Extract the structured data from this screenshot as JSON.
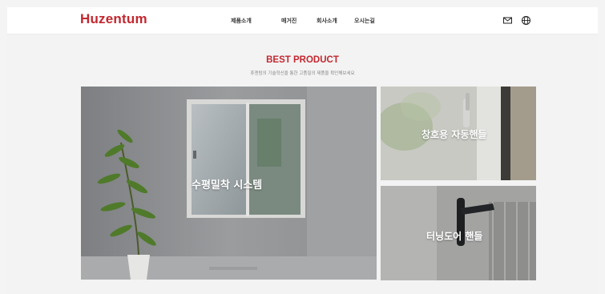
{
  "header": {
    "logo": "Huzentum",
    "nav": [
      "제품소개",
      "매거진",
      "회사소개",
      "오시는길"
    ],
    "icons": [
      "mail-icon",
      "globe-icon"
    ]
  },
  "section": {
    "title": "BEST PRODUCT",
    "subtitle": "휴젠텀의 기술혁신을 통한 고품질의 제품을 확인해보세요"
  },
  "products": [
    {
      "label": "수평밀착 시스템"
    },
    {
      "label": "창호용 자동핸들"
    },
    {
      "label": "터닝도어 핸들"
    }
  ],
  "colors": {
    "brand": "#c3272f",
    "text": "#333333"
  }
}
